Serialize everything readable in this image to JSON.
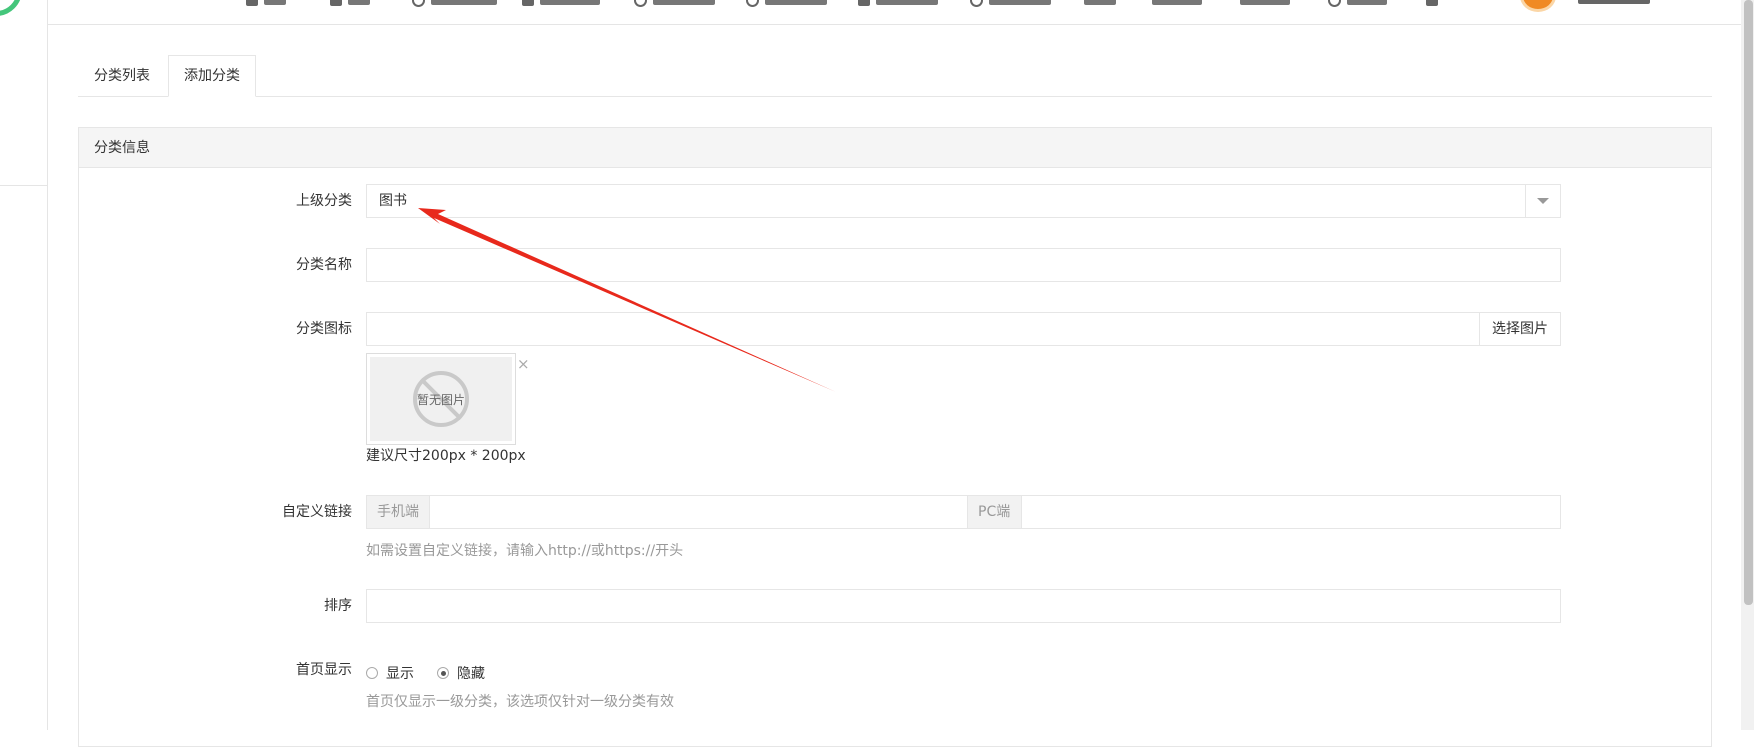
{
  "tabs": [
    {
      "label": "分类列表",
      "active": false
    },
    {
      "label": "添加分类",
      "active": true
    }
  ],
  "card": {
    "title": "分类信息"
  },
  "form": {
    "parent_category": {
      "label": "上级分类",
      "value": "图书"
    },
    "category_name": {
      "label": "分类名称",
      "value": ""
    },
    "category_icon": {
      "label": "分类图标",
      "value": "",
      "select_button": "选择图片",
      "no_image_text": "暂无图片",
      "size_hint": "建议尺寸200px * 200px",
      "remove_glyph": "×"
    },
    "custom_link": {
      "label": "自定义链接",
      "mobile_addon": "手机端",
      "pc_addon": "PC端",
      "mobile_value": "",
      "pc_value": "",
      "hint": "如需设置自定义链接，请输入http://或https://开头"
    },
    "sort": {
      "label": "排序",
      "value": ""
    },
    "homepage_display": {
      "label": "首页显示",
      "options": [
        {
          "label": "显示",
          "checked": false
        },
        {
          "label": "隐藏",
          "checked": true
        }
      ],
      "hint": "首页仅显示一级分类，该选项仅针对一级分类有效"
    }
  },
  "colors": {
    "annotation_arrow": "#e8291c",
    "brand_green": "#44c67b",
    "avatar_orange": "#f08a24"
  }
}
